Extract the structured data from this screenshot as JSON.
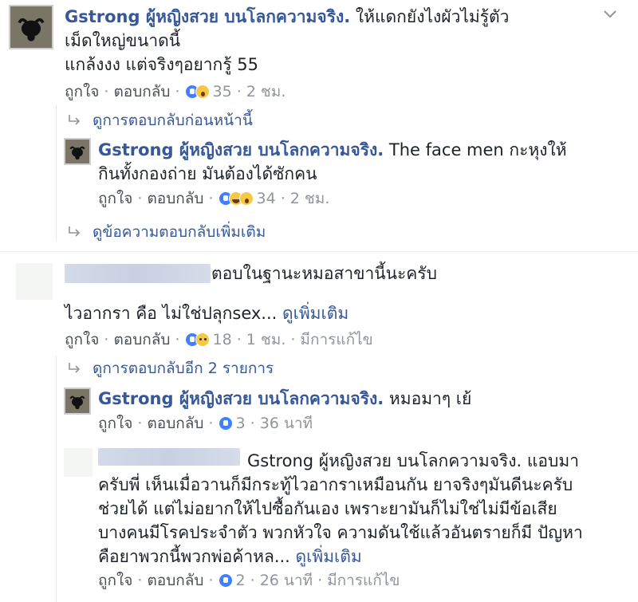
{
  "comments": [
    {
      "author": "Gstrong ผู้หญิงสวย บนโลกความจริง.",
      "text_line1": "ให้แดกยังไงผัวไม่รู้ตัว",
      "text_line2": "เม็ดใหญ่ขนาดนี้",
      "text_line3": "แกล้งงง แต่จริงๆอยากรู้ 55",
      "like_label": "ถูกใจ",
      "reply_label": "ตอบกลับ",
      "reaction_count": "35",
      "time": "2 ชม."
    },
    {
      "more_replies_label": "ดูการตอบกลับก่อนหน้านี้"
    },
    {
      "author": "Gstrong ผู้หญิงสวย บนโลกความจริง.",
      "text_line1": "The face men กะหุงให้",
      "text_line2": "กินทั้งกองถ่าย มันต้องได้ซักคน",
      "like_label": "ถูกใจ",
      "reply_label": "ตอบกลับ",
      "reaction_count": "34",
      "time": "2 ชม."
    },
    {
      "more_replies_label": "ดูข้อความตอบกลับเพิ่มเติม"
    },
    {
      "text_line1": "ตอบในฐานะหมอสาขานี้นะครับ",
      "text_line2": "ไวอากรา คือ ไม่ใช่ปลุกsex...",
      "see_more": "ดูเพิ่มเติม",
      "like_label": "ถูกใจ",
      "reply_label": "ตอบกลับ",
      "reaction_count": "18",
      "time": "1 ชม.",
      "edited": "มีการแก้ไข"
    },
    {
      "more_replies_label": "ดูการตอบกลับอีก 2 รายการ"
    },
    {
      "author": "Gstrong ผู้หญิงสวย บนโลกความจริง.",
      "text_line1": "หมอมาๆ เย้",
      "like_label": "ถูกใจ",
      "reply_label": "ตอบกลับ",
      "reaction_count": "3",
      "time": "36 นาที"
    },
    {
      "text_line1": "Gstrong ผู้หญิงสวย บนโลกความจริง. แอบมา",
      "text_line2": "ครับพี่ เห็นเมื่อวานก็มีกระทู้ไวอากราเหมือนกัน ยาจริงๆมันดีนะครับ",
      "text_line3": "ช่วยได้ แต่ไม่อยากให้ไปซื้อกันเอง เพราะยามันก็ไม่ใช่ไม่มีข้อเสีย",
      "text_line4": "บางคนมีโรคประจำตัว พวกหัวใจ ความดันใช้แล้วอันตรายก็มี ปัญหา",
      "text_line5": "คือยาพวกนี้พวกพ่อค้าหล...",
      "see_more": "ดูเพิ่มเติม",
      "like_label": "ถูกใจ",
      "reply_label": "ตอบกลับ",
      "reaction_count": "2",
      "time": "26 นาที",
      "edited": "มีการแก้ไข"
    }
  ],
  "icons": {
    "reply_arrow": "reply-arrow-icon",
    "options": "chevron-down-icon"
  },
  "colors": {
    "link": "#365899",
    "text": "#1d2129",
    "meta": "#90949c",
    "like_blue": "#4080ff"
  }
}
